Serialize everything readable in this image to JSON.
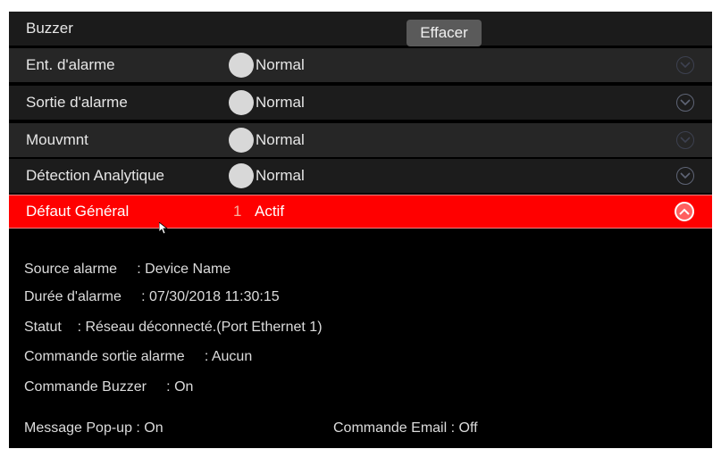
{
  "header": {
    "title": "Buzzer",
    "clear_button": "Effacer"
  },
  "alarm_rows": [
    {
      "name": "Ent. d'alarme",
      "state": "Normal"
    },
    {
      "name": "Sortie d'alarme",
      "state": "Normal"
    },
    {
      "name": "Mouvmnt",
      "state": "Normal"
    },
    {
      "name": "Détection Analytique",
      "state": "Normal"
    }
  ],
  "active_row": {
    "name": "Défaut Général",
    "count": "1",
    "state": "Actif"
  },
  "details": {
    "source": "Source alarme     : Device Name",
    "duration": "Durée d'alarme     : 07/30/2018 11:30:15",
    "status": "Statut    : Réseau déconnecté.(Port Ethernet 1)",
    "output_cmd": "Commande sortie alarme     : Aucun",
    "buzzer_cmd": "Commande Buzzer     : On",
    "popup": "Message Pop-up : On",
    "email": "Commande Email : Off"
  },
  "colors": {
    "active_red": "#ff0000",
    "panel_bg": "#000000"
  },
  "icons": [
    "chevron-down-icon",
    "chevron-up-icon",
    "status-dot-icon",
    "mouse-cursor-icon"
  ]
}
